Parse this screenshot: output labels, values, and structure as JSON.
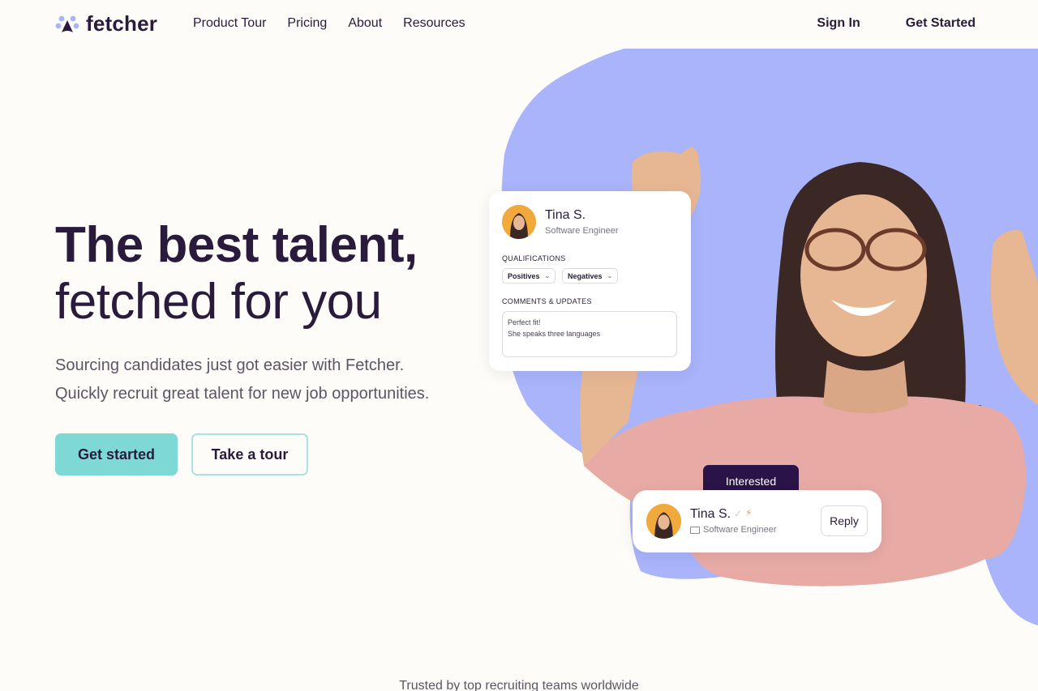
{
  "nav": {
    "logo_text": "fetcher",
    "links": [
      "Product Tour",
      "Pricing",
      "About",
      "Resources"
    ],
    "sign_in": "Sign In",
    "get_started": "Get Started"
  },
  "hero": {
    "headline_bold": "The best talent,",
    "headline_light": "fetched for you",
    "subtitle_line1": "Sourcing candidates just got easier with Fetcher.",
    "subtitle_line2": "Quickly recruit great talent for new job opportunities.",
    "primary_button": "Get started",
    "secondary_button": "Take a tour"
  },
  "profile_card": {
    "name": "Tina S.",
    "role": "Software Engineer",
    "qualifications_label": "QUALIFICATIONS",
    "chips": [
      "Positives",
      "Negatives"
    ],
    "comments_label": "COMMENTS & UPDATES",
    "comment_line1": "Perfect fit!",
    "comment_line2": "She speaks three languages"
  },
  "reply_card": {
    "tooltip": "Interested",
    "name": "Tina S.",
    "role": "Software Engineer",
    "reply_label": "Reply"
  },
  "footer": {
    "trusted_text": "Trusted by top recruiting teams worldwide"
  },
  "colors": {
    "accent_teal": "#7ed9d4",
    "brand_purple": "#2a1b3d",
    "blob_lavender": "#a9b4fa",
    "tooltip_bg": "#2a1447"
  }
}
